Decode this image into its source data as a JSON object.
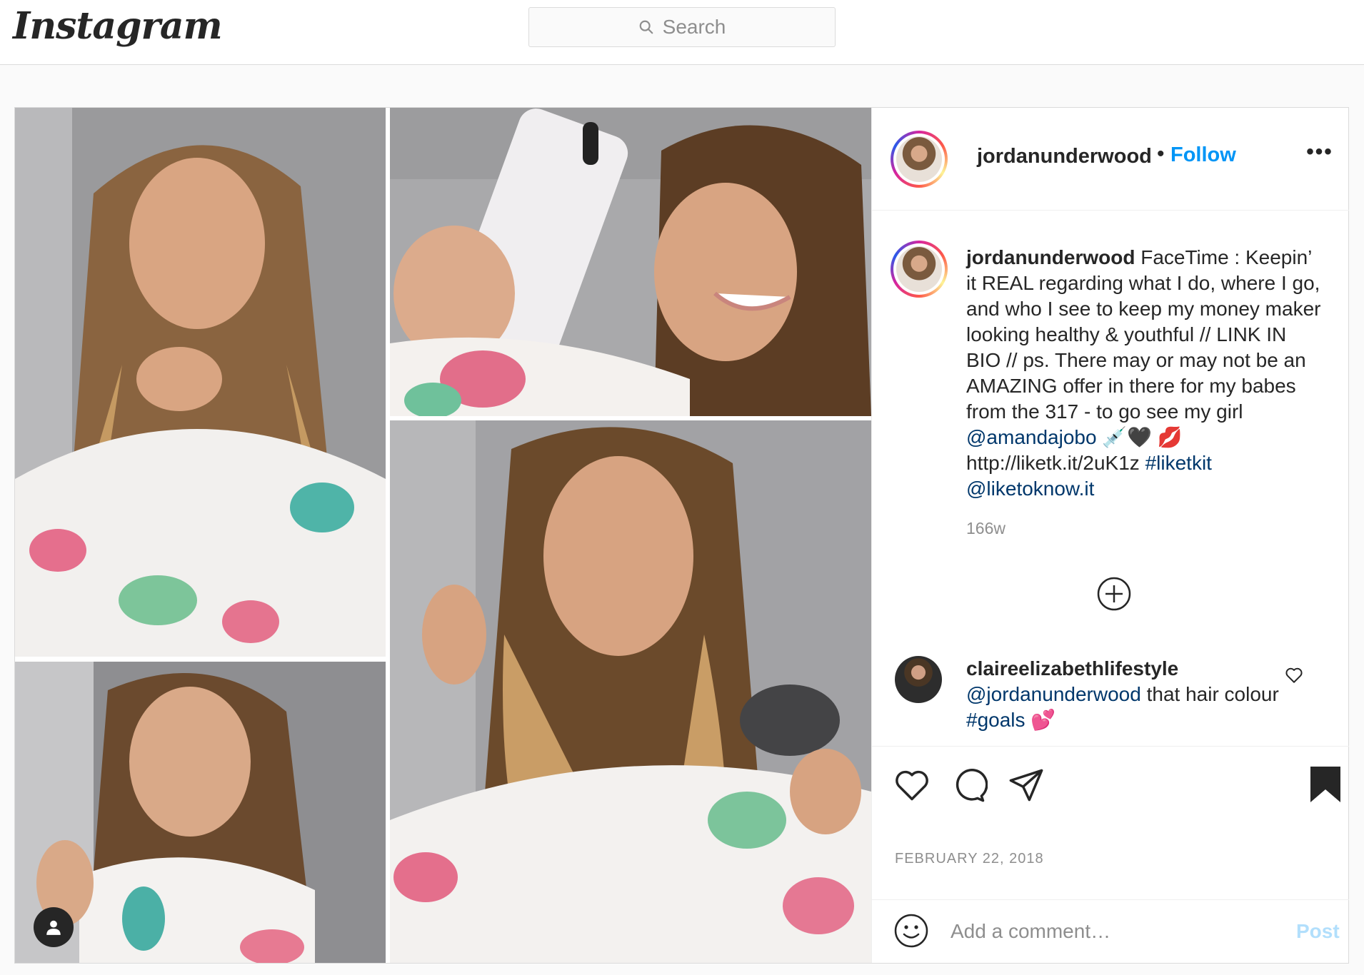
{
  "header": {
    "logo_text": "Instagram",
    "search_placeholder": "Search"
  },
  "post": {
    "username": "jordanunderwood",
    "separator": "•",
    "follow_label": "Follow",
    "more_label": "•••",
    "caption": {
      "username": "jordanunderwood",
      "text_1": " FaceTime : Keepin’ it REAL regarding what I do, where I go, and who I see to keep my money maker looking healthy & youthful // LINK IN BIO // ps. There may or may not be an AMAZING offer in there for my babes from the 317 - to go see my girl ",
      "mention_1": "@amandajobo",
      "emoji_1": " 💉🖤",
      "emoji_2": "💋",
      "text_2": " http://liketk.it/2uK1z ",
      "hashtag_1": "#liketkit",
      "mention_2": "@liketoknow.it"
    },
    "time_ago": "166w",
    "comment": {
      "username": "claireelizabethlifestyle",
      "mention": "@jordanunderwood",
      "text": " that hair colour ",
      "hashtag": "#goals",
      "emoji": " 💕"
    },
    "date": "FEBRUARY 22, 2018",
    "add_comment_placeholder": "Add a comment…",
    "post_label": "Post"
  },
  "icons": {
    "search": "search-icon",
    "more": "more-options-icon",
    "load_more": "plus-circle-icon",
    "comment_like": "heart-icon",
    "like": "heart-icon",
    "comment": "comment-bubble-icon",
    "share": "paper-plane-icon",
    "save": "bookmark-icon",
    "emoji": "smiley-icon",
    "tagged_user": "user-tag-icon"
  },
  "colors": {
    "link_blue": "#0095f6",
    "mention_blue": "#00376b",
    "post_disabled": "#b2dffc",
    "text": "#262626",
    "muted": "#8e8e8e"
  }
}
